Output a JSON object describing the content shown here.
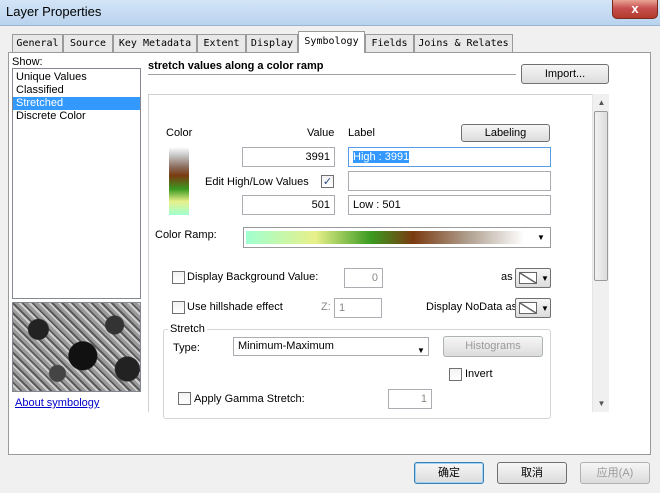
{
  "window": {
    "title": "Layer Properties",
    "close_label": "x"
  },
  "tabs": [
    {
      "label": "General"
    },
    {
      "label": "Source"
    },
    {
      "label": "Key Metadata"
    },
    {
      "label": "Extent"
    },
    {
      "label": "Display"
    },
    {
      "label": "Symbology"
    },
    {
      "label": "Fields"
    },
    {
      "label": "Joins & Relates"
    }
  ],
  "show": {
    "label": "Show:",
    "items": [
      "Unique Values",
      "Classified",
      "Stretched",
      "Discrete Color"
    ],
    "selected": "Stretched"
  },
  "about_link": "About symbology",
  "header_text": "stretch values along a color ramp",
  "import_button": "Import...",
  "columns": {
    "color": "Color",
    "value": "Value",
    "label": "Label"
  },
  "labeling_button": "Labeling",
  "high_value": "3991",
  "high_label": "High : 3991",
  "edit_high_low": "Edit High/Low Values",
  "edit_checked": true,
  "middle_label": "",
  "low_value": "501",
  "low_label": "Low : 501",
  "color_ramp_label": "Color Ramp:",
  "background": {
    "label": "Display Background Value:",
    "value": "0",
    "as": "as"
  },
  "hillshade": {
    "label": "Use hillshade effect",
    "z_label": "Z:",
    "z_value": "1"
  },
  "nodata_label": "Display NoData as",
  "stretch": {
    "title": "Stretch",
    "type_label": "Type:",
    "type_value": "Minimum-Maximum",
    "histograms": "Histograms",
    "invert": "Invert",
    "gamma_label": "Apply Gamma Stretch:",
    "gamma_value": "1"
  },
  "footer": {
    "ok": "确定",
    "cancel": "取消",
    "apply": "应用(A)"
  },
  "colors": {
    "selection": "#3399ff",
    "ramp": [
      "#a0ffd0",
      "#e8f08a",
      "#3a9a20",
      "#7a3a10",
      "#ffffff"
    ]
  }
}
